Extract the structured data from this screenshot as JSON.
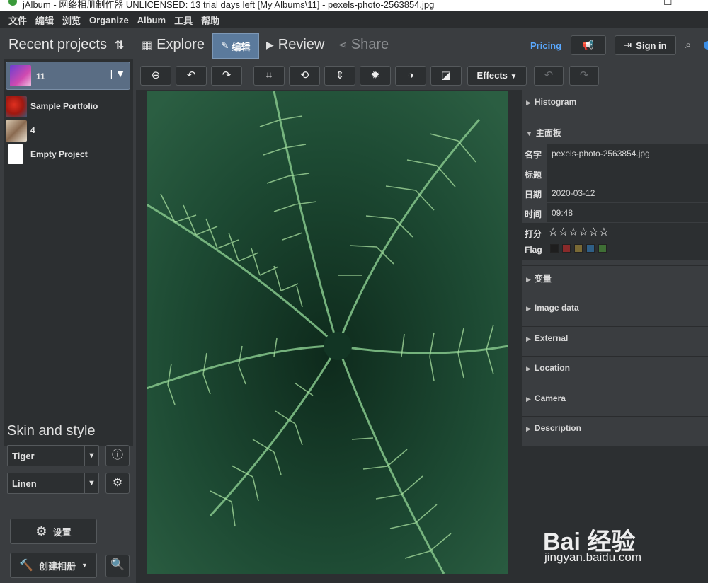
{
  "window": {
    "title": "jAlbum - 网络相册制作器 UNLICENSED: 13 trial days left [My Albums\\11] - pexels-photo-2563854.jpg"
  },
  "menu": [
    "文件",
    "编辑",
    "浏览",
    "Organize",
    "Album",
    "工具",
    "帮助"
  ],
  "left": {
    "recent_title": "Recent projects",
    "projects": [
      {
        "label": "11",
        "selected": true
      },
      {
        "label": "Sample Portfolio"
      },
      {
        "label": "4"
      },
      {
        "label": "Empty Project"
      }
    ],
    "skin_title": "Skin and style",
    "skin_value": "Tiger",
    "style_value": "Linen",
    "settings_label": "设置",
    "create_label": "创建相册"
  },
  "tabs": {
    "explore": "Explore",
    "edit": "编辑",
    "review": "Review",
    "share": "Share",
    "active": "edit"
  },
  "header": {
    "pricing": "Pricing",
    "sign_in": "Sign in"
  },
  "toolbar": {
    "effects": "Effects"
  },
  "info": {
    "histogram": "Histogram",
    "main_panel": "主面板",
    "fields": [
      {
        "key": "名字",
        "value": "pexels-photo-2563854.jpg"
      },
      {
        "key": "标题",
        "value": ""
      },
      {
        "key": "日期",
        "value": "2020-03-12"
      },
      {
        "key": "时间",
        "value": "09:48"
      }
    ],
    "rating_key": "打分",
    "rating": 0,
    "rating_max": 6,
    "flag_key": "Flag",
    "flag_colors": [
      "#1e1e1e",
      "#8a2a2a",
      "#7a6a35",
      "#2f5f86",
      "#3f6f35"
    ],
    "sections": [
      "变量",
      "Image data",
      "External",
      "Location",
      "Camera",
      "Description"
    ]
  },
  "watermark": {
    "brand": "Bai 经验",
    "url": "jingyan.baidu.com"
  }
}
